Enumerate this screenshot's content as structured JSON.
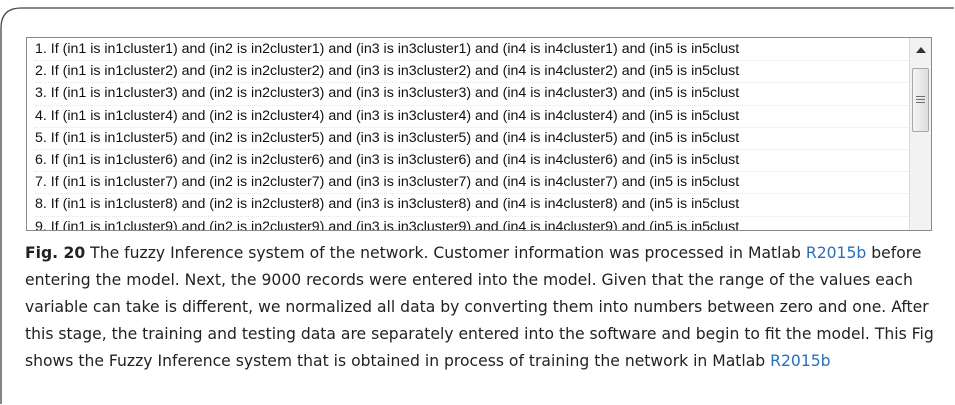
{
  "list": {
    "rules": [
      "1. If (in1 is in1cluster1) and (in2 is in2cluster1) and (in3 is in3cluster1) and (in4 is in4cluster1) and (in5 is in5clust",
      "2. If (in1 is in1cluster2) and (in2 is in2cluster2) and (in3 is in3cluster2) and (in4 is in4cluster2) and (in5 is in5clust",
      "3. If (in1 is in1cluster3) and (in2 is in2cluster3) and (in3 is in3cluster3) and (in4 is in4cluster3) and (in5 is in5clust",
      "4. If (in1 is in1cluster4) and (in2 is in2cluster4) and (in3 is in3cluster4) and (in4 is in4cluster4) and (in5 is in5clust",
      "5. If (in1 is in1cluster5) and (in2 is in2cluster5) and (in3 is in3cluster5) and (in4 is in4cluster5) and (in5 is in5clust",
      "6. If (in1 is in1cluster6) and (in2 is in2cluster6) and (in3 is in3cluster6) and (in4 is in4cluster6) and (in5 is in5clust",
      "7. If (in1 is in1cluster7) and (in2 is in2cluster7) and (in3 is in3cluster7) and (in4 is in4cluster7) and (in5 is in5clust",
      "8. If (in1 is in1cluster8) and (in2 is in2cluster8) and (in3 is in3cluster8) and (in4 is in4cluster8) and (in5 is in5clust",
      "9. If (in1 is in1cluster9) and (in2 is in2cluster9) and (in3 is in3cluster9) and (in4 is in4cluster9) and (in5 is in5clust"
    ],
    "scroll_up_icon": "triangle-up-icon",
    "thumb_grip_icon": "grip-lines-icon"
  },
  "caption": {
    "label": "Fig. 20",
    "text_1": " The fuzzy Inference system of the network. Customer information was processed in Matlab ",
    "link_1": "R2015b",
    "text_2": " before entering the model. Next, the 9000 records were entered into the model. Given that the range of the values each variable can take is different, we normalized all data by converting them into numbers between zero and one. After this stage, the training and testing data are separately entered into the software and begin to fit the model. This Fig shows the Fuzzy Inference system that is obtained in process of training the network in Matlab ",
    "link_2": "R2015b"
  },
  "colors": {
    "link": "#2a6ebb",
    "frame": "#444444"
  }
}
